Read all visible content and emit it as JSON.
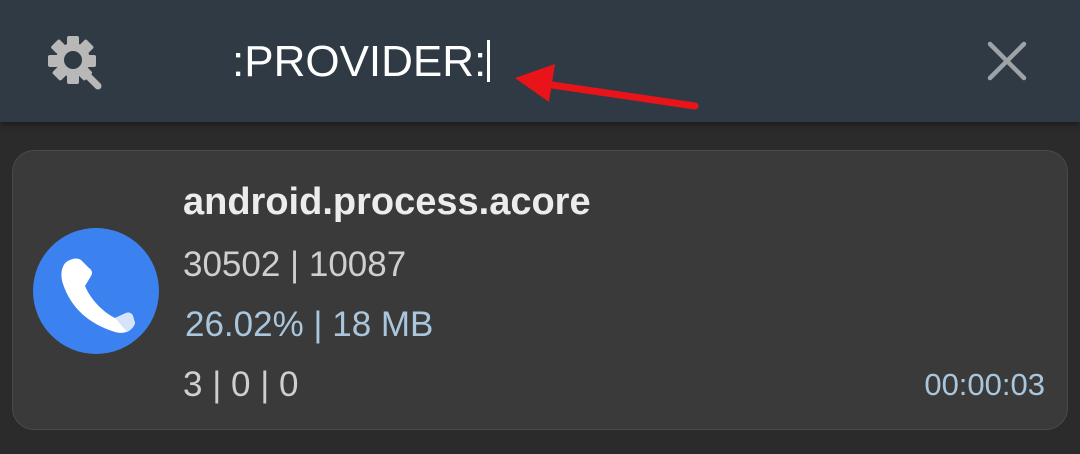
{
  "search": {
    "query": ":PROVIDER:",
    "icon": "search-settings-icon",
    "clear_icon": "close-icon"
  },
  "process": {
    "name": "android.process.acore",
    "ids": "30502 | 10087",
    "usage": "26.02%  |  18 MB",
    "counts": "3 | 0 | 0",
    "duration": "00:00:03",
    "icon": "phone-icon"
  },
  "colors": {
    "topbar": "#2f3a45",
    "card": "#3a3a3a",
    "accent_blue": "#3b82f0",
    "annotation_arrow": "#e8141a",
    "stat_blue": "#a9c6dc"
  }
}
